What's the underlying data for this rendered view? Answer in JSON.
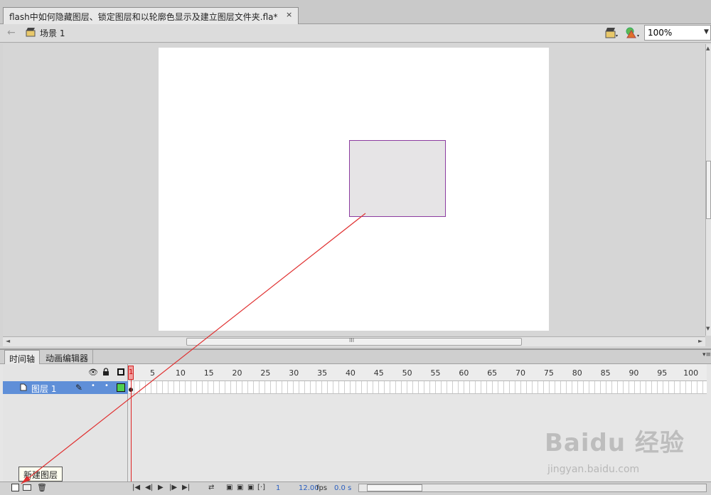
{
  "document": {
    "tab_title": "flash中如何隐藏图层、锁定图层和以轮廓色显示及建立图层文件夹.fla*",
    "tab_close": "×"
  },
  "scene_bar": {
    "back_icon": "←",
    "scene_label": "场景 1",
    "zoom_value": "100%",
    "zoom_arrow": "▼"
  },
  "stage": {
    "background": "#ffffff",
    "shape_fill": "#e6e4e6",
    "shape_stroke": "#8c3ca0"
  },
  "scrollbars": {
    "up": "▲",
    "down": "▼",
    "left": "◄",
    "right": "►",
    "grip": "III"
  },
  "panel": {
    "tab_timeline": "时间轴",
    "tab_motion_editor": "动画编辑器",
    "menu_icon": "▾≡",
    "eye_icon": "👁"
  },
  "timeline": {
    "ruler_numbers": [
      "5",
      "10",
      "15",
      "20",
      "25",
      "30",
      "35",
      "40",
      "45",
      "50",
      "55",
      "60",
      "65",
      "70",
      "75",
      "80",
      "85",
      "90",
      "95",
      "100"
    ],
    "current_frame": "1",
    "layers": [
      {
        "name": "图层 1",
        "color": "#4fd04f",
        "pencil": "✎",
        "dot": "•"
      }
    ]
  },
  "bottom_bar": {
    "tooltip": "新建图层",
    "delete_icon": "🗑",
    "controls": [
      "|◀",
      "◀|",
      "▶",
      "|▶",
      "▶|"
    ],
    "onion_icons": [
      "⇄",
      "▣",
      "▣",
      "▣",
      "[·]"
    ],
    "current_frame": "1",
    "fps": "12.00",
    "fps_unit": "fps",
    "time": "0.0 s"
  },
  "watermark": {
    "text": "Baidu 经验",
    "url": "jingyan.baidu.com"
  }
}
